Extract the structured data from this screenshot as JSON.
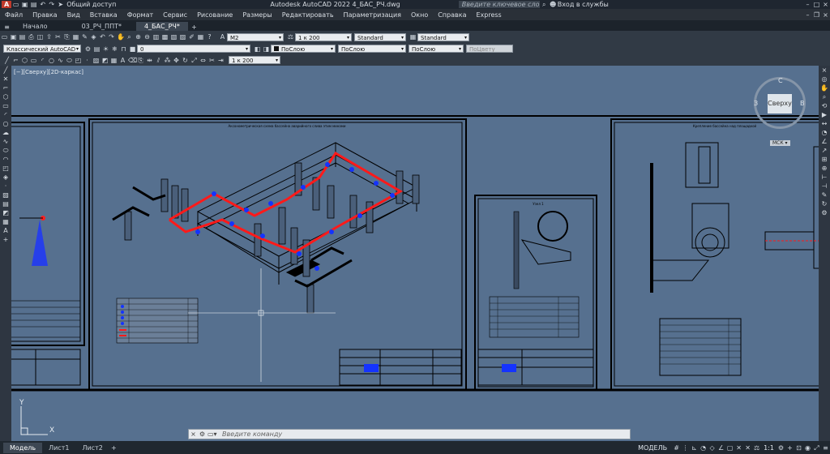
{
  "app": {
    "title": "Autodesk AutoCAD 2022    4_БАС_РЧ.dwg",
    "share_label": "Общий доступ",
    "search_placeholder": "Введите ключевое слово/фразу",
    "signin_label": "Вход в службы"
  },
  "menu": [
    "Файл",
    "Правка",
    "Вид",
    "Вставка",
    "Формат",
    "Сервис",
    "Рисование",
    "Размеры",
    "Редактировать",
    "Параметризация",
    "Окно",
    "Справка",
    "Express"
  ],
  "doc_tabs": [
    {
      "label": "Начало",
      "active": false
    },
    {
      "label": "03_РЧ_ППТ*",
      "active": false
    },
    {
      "label": "4_БАС_РЧ*",
      "active": true
    }
  ],
  "toolbar1": {
    "textstyle": "М2",
    "scale": "1 к 200",
    "dimstyle": "Standard",
    "tablestyle": "Standard"
  },
  "toolbar2": {
    "workspace": "Классический AutoCAD",
    "layer": "0",
    "color": "ПоСлою",
    "linetype": "ПоСлою",
    "lineweight": "ПоСлою",
    "plotstyle": "ПоЦвету"
  },
  "toolbar3": {
    "scale": "1 к 200"
  },
  "viewport": {
    "label": "[−][Сверху][2D-каркас]"
  },
  "viewcube": {
    "face": "Сверху",
    "north": "С",
    "west": "З",
    "east": "В",
    "wcs": "МСК"
  },
  "drawing": {
    "main_title": "Аксонометрическая схема бассейна аварийного слива этим минами",
    "mid_title": "Узел 1",
    "right_title": "Крепление бассейна над площадкой"
  },
  "ucs": {
    "x": "X",
    "y": "Y"
  },
  "command": {
    "placeholder": "Введите команду"
  },
  "layout_tabs": [
    {
      "label": "Модель",
      "active": true
    },
    {
      "label": "Лист1",
      "active": false
    },
    {
      "label": "Лист2",
      "active": false
    }
  ],
  "status": {
    "mode": "МОДЕЛЬ",
    "scale": "1:1"
  }
}
